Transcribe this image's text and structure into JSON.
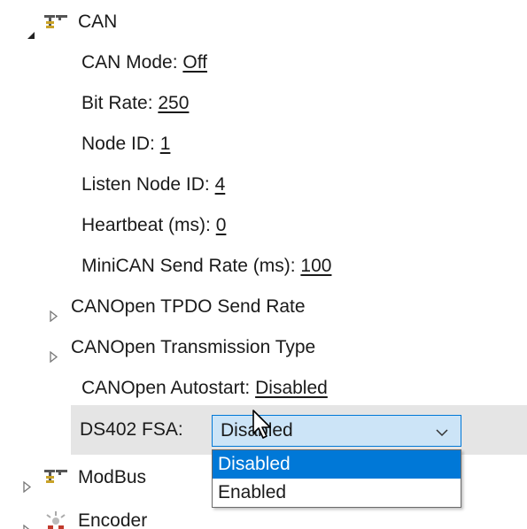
{
  "tree": {
    "can": {
      "label": "CAN",
      "icon": "network-icon"
    },
    "props": [
      {
        "name": "CAN Mode: ",
        "value": "Off"
      },
      {
        "name": "Bit Rate: ",
        "value": "250"
      },
      {
        "name": "Node ID: ",
        "value": "1"
      },
      {
        "name": "Listen Node ID: ",
        "value": "4"
      },
      {
        "name": "Heartbeat (ms): ",
        "value": "0"
      },
      {
        "name": "MiniCAN Send Rate (ms): ",
        "value": "100"
      }
    ],
    "groups": [
      {
        "label": "CANOpen TPDO Send Rate"
      },
      {
        "label": "CANOpen Transmission Type"
      }
    ],
    "autostart": {
      "name": "CANOpen Autostart: ",
      "value": "Disabled"
    },
    "ds402": {
      "name": "DS402 FSA:",
      "value": "Disabled"
    },
    "modbus": {
      "label": "ModBus",
      "icon": "network-icon"
    },
    "encoder": {
      "label": "Encoder",
      "icon": "encoder-icon"
    }
  },
  "dropdown": {
    "options": [
      "Disabled",
      "Enabled"
    ],
    "selected": "Disabled"
  },
  "colors": {
    "selection": "#0078d7",
    "combo_bg": "#cce4f7",
    "edit_row_bg": "#e5e5e5"
  }
}
